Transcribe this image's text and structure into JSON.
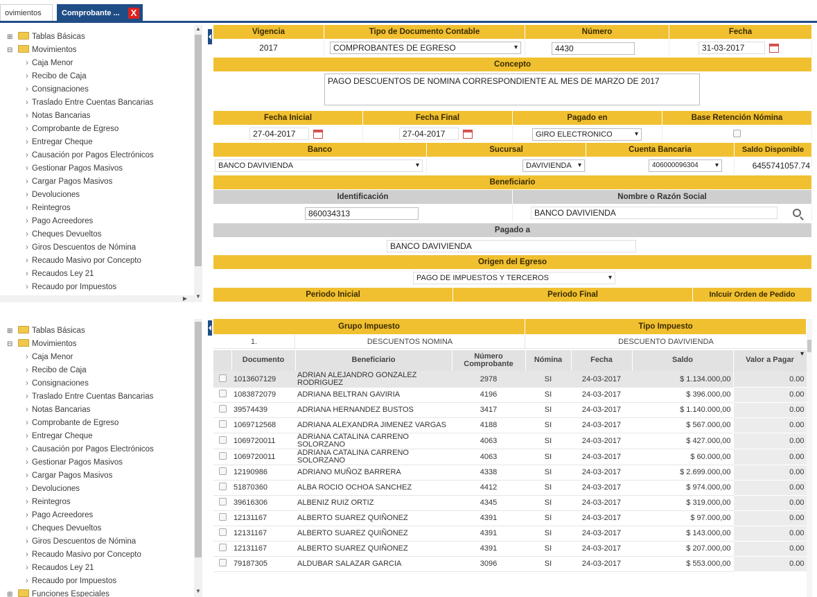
{
  "tabs": {
    "movimientos": "ovimientos",
    "comprobante": "Comprobante ...",
    "close": "X"
  },
  "tree": {
    "roots": [
      "Tablas Básicas",
      "Movimientos"
    ],
    "items": [
      "Caja Menor",
      "Recibo de Caja",
      "Consignaciones",
      "Traslado Entre Cuentas Bancarias",
      "Notas Bancarias",
      "Comprobante de Egreso",
      "Entregar Cheque",
      "Causación por Pagos Electrónicos",
      "Gestionar Pagos Masivos",
      "Cargar Pagos Masivos",
      "Devoluciones",
      "Reintegros",
      "Pago Acreedores",
      "Cheques Devueltos",
      "Giros Descuentos de Nómina",
      "Recaudo Masivo por Concepto",
      "Recaudos Ley 21",
      "Recaudo por Impuestos"
    ],
    "items_bottom_recaudos": "Recaudos Ley 21",
    "item_top_recaudos": "Recaudos Ley 21",
    "last_root": "Funciones Especiales"
  },
  "form": {
    "vigencia_h": "Vigencia",
    "vigencia": "2017",
    "tipo_h": "Tipo de Documento Contable",
    "tipo": "COMPROBANTES DE EGRESO",
    "numero_h": "Número",
    "numero": "4430",
    "fecha_h": "Fecha",
    "fecha": "31-03-2017",
    "concepto_h": "Concepto",
    "concepto": "PAGO DESCUENTOS DE NOMINA CORRESPONDIENTE AL MES DE MARZO DE 2017",
    "fecha_ini_h": "Fecha Inicial",
    "fecha_ini": "27-04-2017",
    "fecha_fin_h": "Fecha Final",
    "fecha_fin": "27-04-2017",
    "pagado_en_h": "Pagado en",
    "pagado_en": "GIRO ELECTRONICO",
    "base_ret_h": "Base Retención Nómina",
    "banco_h": "Banco",
    "banco": "BANCO DAVIVIENDA",
    "sucursal_h": "Sucursal",
    "sucursal": "DAVIVIENDA",
    "cuenta_h": "Cuenta Bancaria",
    "cuenta": "406000096304",
    "saldo_h": "Saldo Disponible",
    "saldo": "6455741057.74",
    "beneficiario_h": "Beneficiario",
    "ident_h": "Identificación",
    "ident": "860034313",
    "nombre_h": "Nombre o Razón Social",
    "nombre": "BANCO DAVIVIENDA",
    "pagado_a_h": "Pagado a",
    "pagado_a": "BANCO DAVIVIENDA",
    "origen_h": "Origen del Egreso",
    "origen": "PAGO DE IMPUESTOS Y TERCEROS",
    "periodo_ini_h": "Periodo Inicial",
    "periodo_fin_h": "Periodo Final",
    "orden_h": "Inlcuir Orden de Pedido"
  },
  "taxes": {
    "grupo_h": "Grupo Impuesto",
    "tipo_h": "Tipo Impuesto",
    "num": "1.",
    "grupo": "DESCUENTOS NOMINA",
    "tipo": "DESCUENTO DAVIVIENDA",
    "cols": [
      "Documento",
      "Beneficiario",
      "Número Comprobante",
      "Nómina",
      "Fecha",
      "Saldo",
      "Valor a Pagar"
    ],
    "rows": [
      {
        "doc": "1013607129",
        "ben": "ADRIAN ALEJANDRO GONZALEZ RODRIGUEZ",
        "num": "2978",
        "nom": "SI",
        "fecha": "24-03-2017",
        "saldo": "$ 1.134.000,00",
        "valor": "0.00"
      },
      {
        "doc": "1083872079",
        "ben": "ADRIANA BELTRAN GAVIRIA",
        "num": "4196",
        "nom": "SI",
        "fecha": "24-03-2017",
        "saldo": "$ 396.000,00",
        "valor": "0.00"
      },
      {
        "doc": "39574439",
        "ben": "ADRIANA HERNANDEZ BUSTOS",
        "num": "3417",
        "nom": "SI",
        "fecha": "24-03-2017",
        "saldo": "$ 1.140.000,00",
        "valor": "0.00"
      },
      {
        "doc": "1069712568",
        "ben": "ADRIANA ALEXANDRA JIMENEZ VARGAS",
        "num": "4188",
        "nom": "SI",
        "fecha": "24-03-2017",
        "saldo": "$ 567.000,00",
        "valor": "0.00"
      },
      {
        "doc": "1069720011",
        "ben": "ADRIANA CATALINA CARREÑO SOLORZANO",
        "num": "4063",
        "nom": "SI",
        "fecha": "24-03-2017",
        "saldo": "$ 427.000,00",
        "valor": "0.00"
      },
      {
        "doc": "1069720011",
        "ben": "ADRIANA CATALINA CARREÑO SOLORZANO",
        "num": "4063",
        "nom": "SI",
        "fecha": "24-03-2017",
        "saldo": "$ 60.000,00",
        "valor": "0.00"
      },
      {
        "doc": "12190986",
        "ben": "ADRIANO MUÑOZ BARRERA",
        "num": "4338",
        "nom": "SI",
        "fecha": "24-03-2017",
        "saldo": "$ 2.699.000,00",
        "valor": "0.00"
      },
      {
        "doc": "51870360",
        "ben": "ALBA ROCIO OCHOA SANCHEZ",
        "num": "4412",
        "nom": "SI",
        "fecha": "24-03-2017",
        "saldo": "$ 974.000,00",
        "valor": "0.00"
      },
      {
        "doc": "39616306",
        "ben": "ALBENIZ RUIZ ORTIZ",
        "num": "4345",
        "nom": "SI",
        "fecha": "24-03-2017",
        "saldo": "$ 319.000,00",
        "valor": "0.00"
      },
      {
        "doc": "12131167",
        "ben": "ALBERTO SUAREZ QUIÑONEZ",
        "num": "4391",
        "nom": "SI",
        "fecha": "24-03-2017",
        "saldo": "$ 97.000,00",
        "valor": "0.00"
      },
      {
        "doc": "12131167",
        "ben": "ALBERTO SUAREZ QUIÑONEZ",
        "num": "4391",
        "nom": "SI",
        "fecha": "24-03-2017",
        "saldo": "$ 143.000,00",
        "valor": "0.00"
      },
      {
        "doc": "12131167",
        "ben": "ALBERTO SUAREZ QUIÑONEZ",
        "num": "4391",
        "nom": "SI",
        "fecha": "24-03-2017",
        "saldo": "$ 207.000,00",
        "valor": "0.00"
      },
      {
        "doc": "79187305",
        "ben": "ALDUBAR SALAZAR GARCIA",
        "num": "3096",
        "nom": "SI",
        "fecha": "24-03-2017",
        "saldo": "$ 553.000,00",
        "valor": "0.00"
      }
    ]
  }
}
